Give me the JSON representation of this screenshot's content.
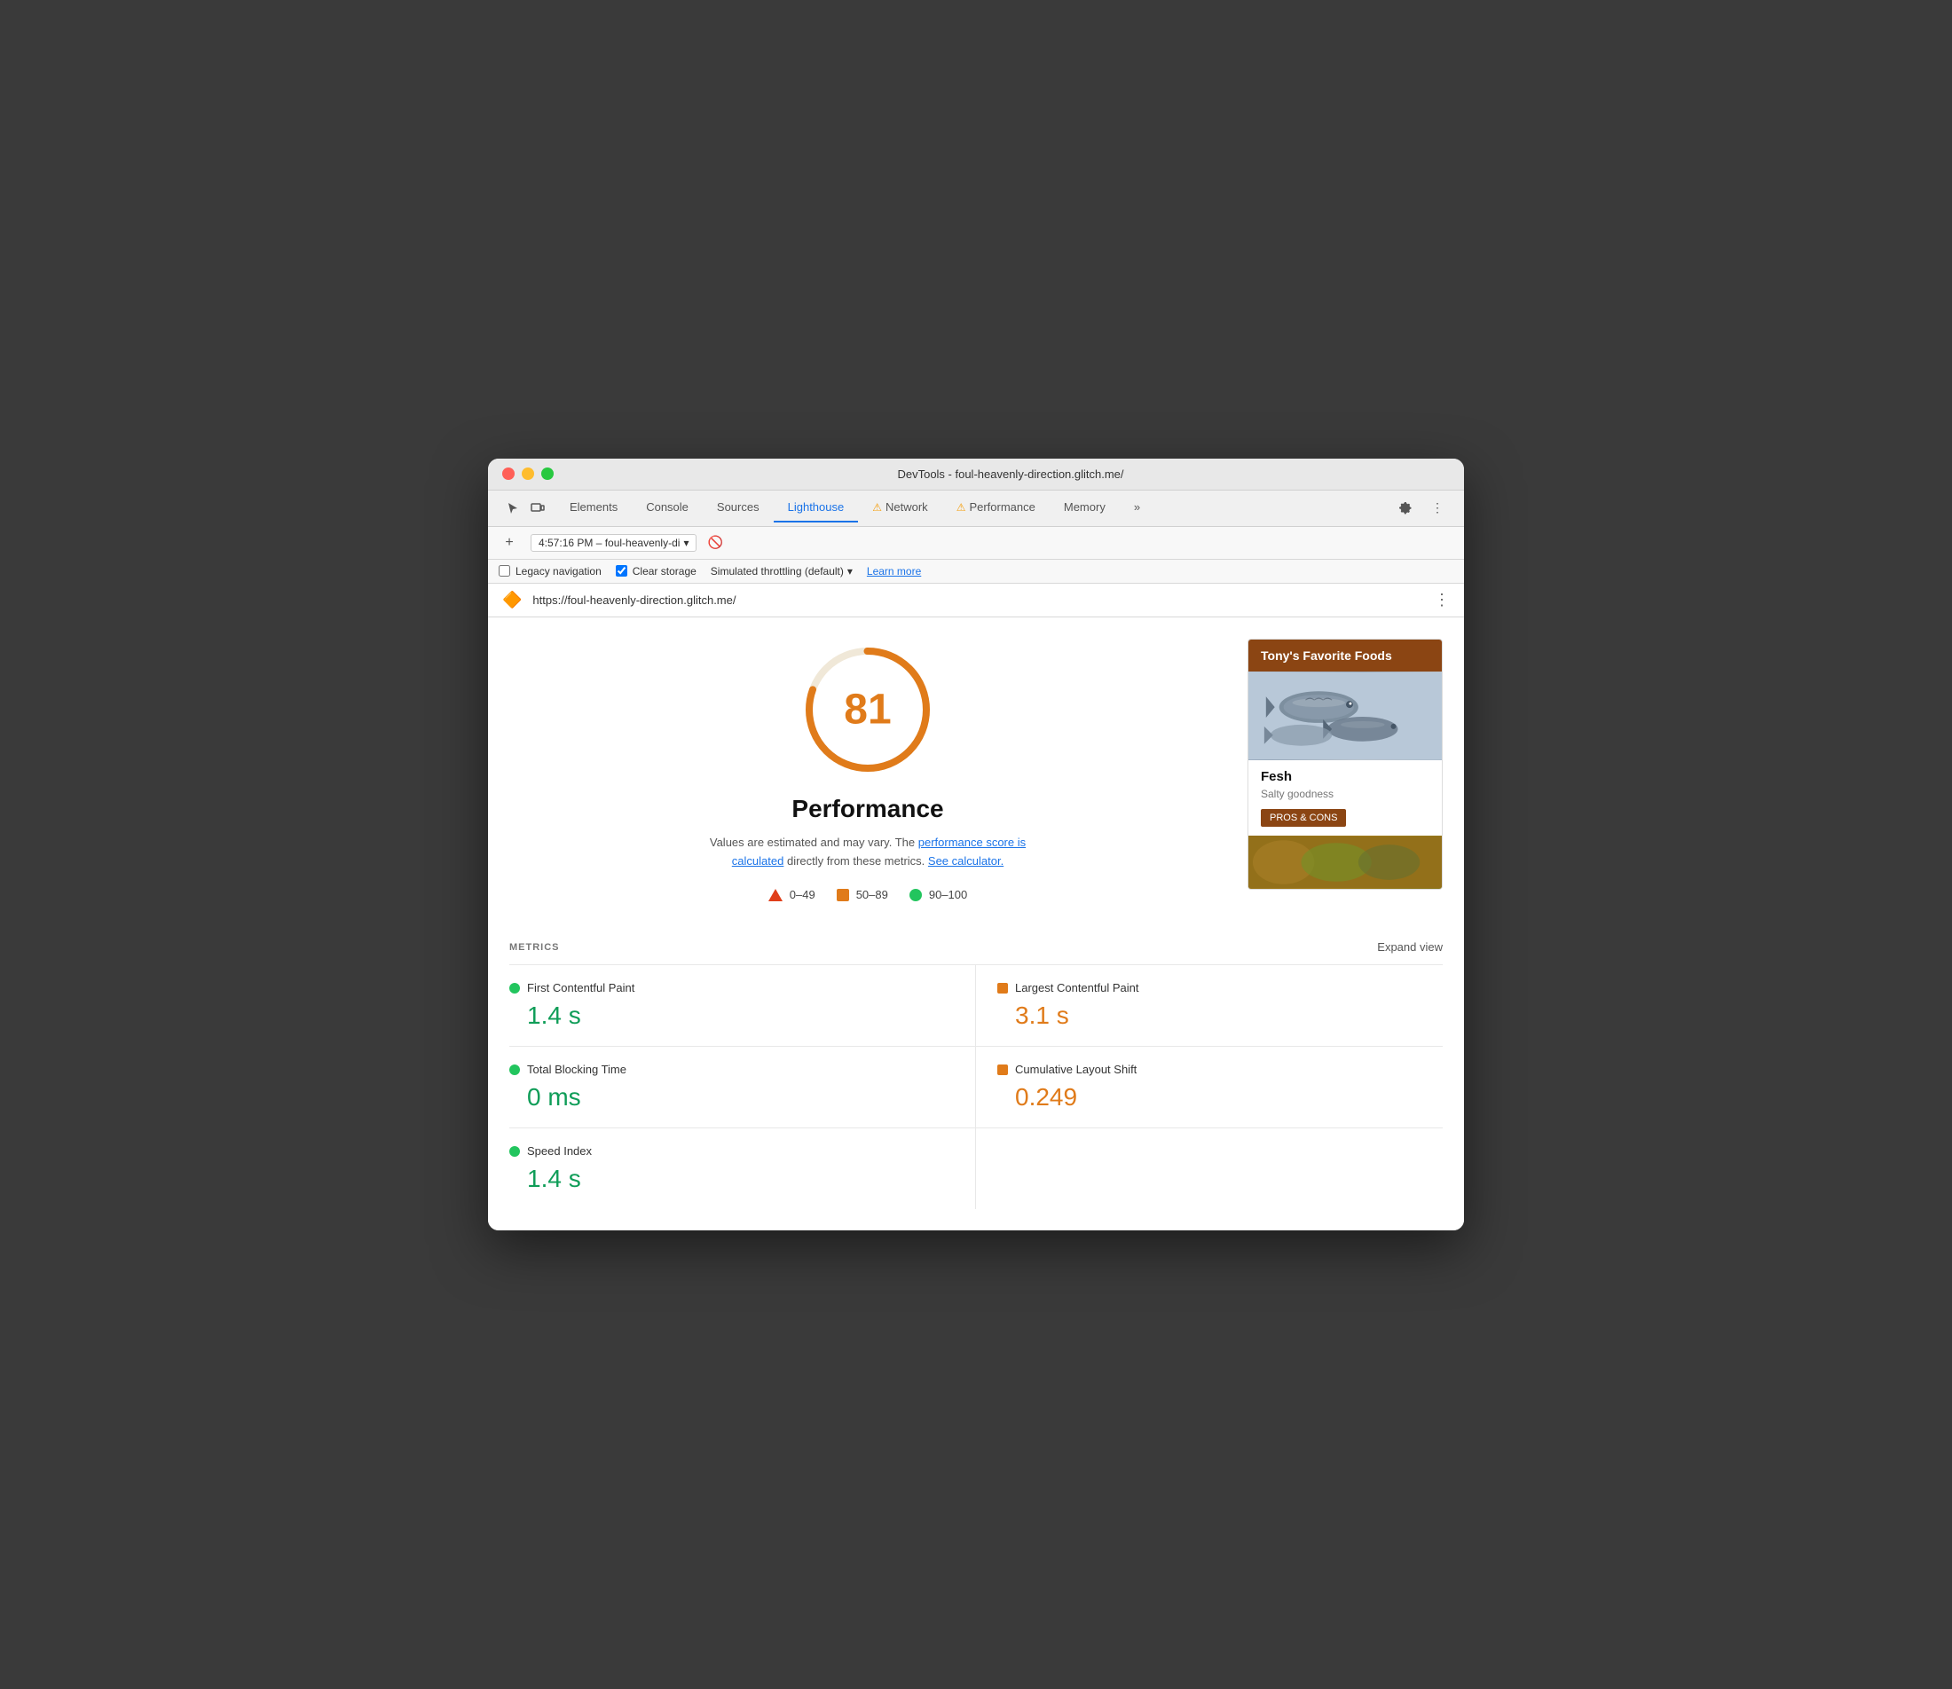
{
  "window": {
    "title": "DevTools - foul-heavenly-direction.glitch.me/"
  },
  "tabs": {
    "elements": "Elements",
    "console": "Console",
    "sources": "Sources",
    "lighthouse": "Lighthouse",
    "network": "Network",
    "performance": "Performance",
    "memory": "Memory",
    "more": "»"
  },
  "toolbar": {
    "session_label": "4:57:16 PM – foul-heavenly-di",
    "dropdown_arrow": "▾"
  },
  "options": {
    "legacy_nav_label": "Legacy navigation",
    "clear_storage_label": "Clear storage",
    "throttling_label": "Simulated throttling (default)",
    "throttling_arrow": "▾",
    "learn_more": "Learn more"
  },
  "url_bar": {
    "url": "https://foul-heavenly-direction.glitch.me/"
  },
  "score": {
    "value": "81",
    "label": "Performance",
    "subtitle_text": "Values are estimated and may vary. The",
    "link1": "performance score is calculated",
    "link2": " directly from these metrics. ",
    "link3": "See calculator.",
    "color": "#e07b1a"
  },
  "legend": {
    "range1": "0–49",
    "range2": "50–89",
    "range3": "90–100"
  },
  "food_card": {
    "header": "Tony's Favorite Foods",
    "name": "Fesh",
    "description": "Salty goodness",
    "button": "PROS & CONS"
  },
  "metrics": {
    "title": "METRICS",
    "expand": "Expand view",
    "items": [
      {
        "name": "First Contentful Paint",
        "value": "1.4 s",
        "status": "green"
      },
      {
        "name": "Largest Contentful Paint",
        "value": "3.1 s",
        "status": "orange"
      },
      {
        "name": "Total Blocking Time",
        "value": "0 ms",
        "status": "green"
      },
      {
        "name": "Cumulative Layout Shift",
        "value": "0.249",
        "status": "orange"
      },
      {
        "name": "Speed Index",
        "value": "1.4 s",
        "status": "green"
      }
    ]
  }
}
